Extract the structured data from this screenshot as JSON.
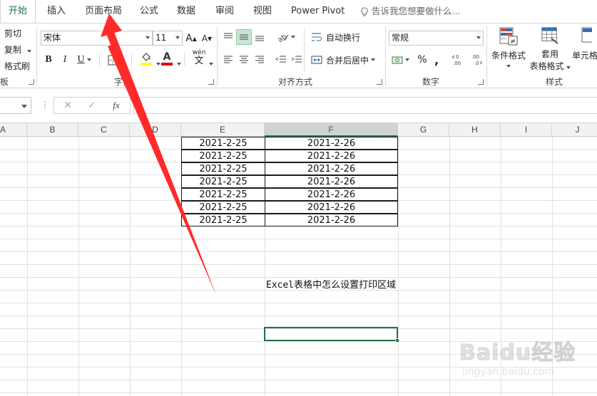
{
  "tabs": [
    {
      "label": "开始",
      "active": true
    },
    {
      "label": "插入",
      "active": false
    },
    {
      "label": "页面布局",
      "active": false
    },
    {
      "label": "公式",
      "active": false
    },
    {
      "label": "数据",
      "active": false
    },
    {
      "label": "审阅",
      "active": false
    },
    {
      "label": "视图",
      "active": false
    },
    {
      "label": "Power Pivot",
      "active": false
    }
  ],
  "tell_me": "告诉我您想要做什么...",
  "clipboard": {
    "cut": "剪切",
    "copy": "复制",
    "format_painter": "格式刷",
    "group_label": "板"
  },
  "font": {
    "name": "宋体",
    "size": "11",
    "grow": "A",
    "shrink": "A",
    "bold": "B",
    "italic": "I",
    "underline": "U",
    "font_color_letter": "A",
    "wen": "wén",
    "wen_char": "文",
    "group_label": "字体"
  },
  "alignment": {
    "wrap_text": "自动换行",
    "merge_center": "合并后居中",
    "group_label": "对齐方式"
  },
  "number": {
    "format": "常规",
    "percent": "%",
    "comma": ",",
    "inc_decimal": "←0 .00",
    "dec_decimal": ".00 →0",
    "group_label": "数字"
  },
  "styles": {
    "conditional_formatting": "条件格式",
    "format_as_table_line1": "套用",
    "format_as_table_line2": "表格格式",
    "cell_styles": "单元格",
    "group_label": "样式"
  },
  "formula_bar": {
    "fx": "fx",
    "cancel": "✕",
    "enter": "✓",
    "value": ""
  },
  "columns": [
    "A",
    "B",
    "C",
    "D",
    "E",
    "F",
    "G",
    "H",
    "I",
    "J"
  ],
  "selected_column": "F",
  "table": {
    "rows": [
      [
        "2021-2-25",
        "2021-2-26"
      ],
      [
        "2021-2-25",
        "2021-2-26"
      ],
      [
        "2021-2-25",
        "2021-2-26"
      ],
      [
        "2021-2-25",
        "2021-2-26"
      ],
      [
        "2021-2-25",
        "2021-2-26"
      ],
      [
        "2021-2-25",
        "2021-2-26"
      ],
      [
        "2021-2-25",
        "2021-2-26"
      ]
    ]
  },
  "note": "Excel表格中怎么设置打印区域",
  "watermark": {
    "brand": "Baidu经验",
    "url": "jingyan.baidu.com"
  },
  "colors": {
    "accent": "#217346",
    "arrow": "#ff2a2a"
  }
}
